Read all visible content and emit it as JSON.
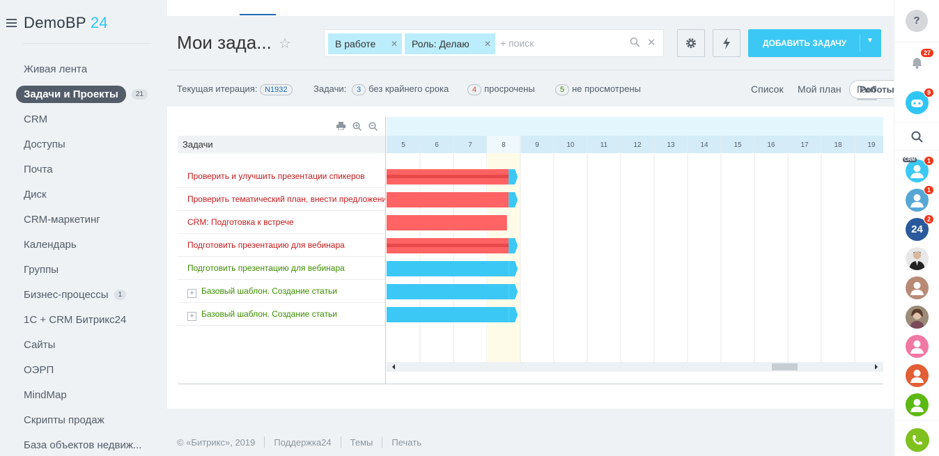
{
  "brand": {
    "name": "DemoBP",
    "num": "24"
  },
  "menu": [
    {
      "label": "Живая лента"
    },
    {
      "label": "Задачи и Проекты",
      "count": "21",
      "active": true
    },
    {
      "label": "CRM"
    },
    {
      "label": "Доступы"
    },
    {
      "label": "Почта"
    },
    {
      "label": "Диск"
    },
    {
      "label": "CRM-маркетинг"
    },
    {
      "label": "Календарь"
    },
    {
      "label": "Группы"
    },
    {
      "label": "Бизнес-процессы",
      "count": "1"
    },
    {
      "label": "1С + CRM Битрикс24"
    },
    {
      "label": "Сайты"
    },
    {
      "label": "ОЭРП"
    },
    {
      "label": "MindMap"
    },
    {
      "label": "Скрипты продаж"
    },
    {
      "label": "База объектов недвиж..."
    }
  ],
  "page": {
    "title": "Мои зада..."
  },
  "filter": {
    "chip1": "В работе",
    "chip2": "Роль: Делаю",
    "placeholder": "+ поиск"
  },
  "toolbar": {
    "add_task": "ДОБАВИТЬ ЗАДАЧУ"
  },
  "subbar": {
    "iteration_label": "Текущая итерация:",
    "iteration_value": "N1932",
    "tasks_label": "Задачи:",
    "no_deadline_count": "3",
    "no_deadline_label": "без крайнего срока",
    "overdue_count": "4",
    "overdue_label": "просрочены",
    "unseen_count": "5",
    "unseen_label": "не просмотрены",
    "robots": "Роботы",
    "views": [
      "Список",
      "Мой план",
      "Гант"
    ]
  },
  "gantt": {
    "column_header": "Задачи",
    "days": [
      "5",
      "6",
      "7",
      "8",
      "9",
      "10",
      "11",
      "12",
      "13",
      "14",
      "15",
      "16",
      "17",
      "18",
      "19"
    ],
    "today": "8",
    "tasks": [
      {
        "name": "Проверить и улучшить презентации спикеров",
        "status": "overdue",
        "start": 5,
        "end": 8.9,
        "arrow": true,
        "stripe": true
      },
      {
        "name": "Проверить тематический план, внести предложения",
        "status": "overdue",
        "start": 5,
        "end": 8.9,
        "arrow": true,
        "stripe": false
      },
      {
        "name": "CRM: Подготовка к встрече",
        "status": "overdue",
        "start": 5,
        "end": 8.6,
        "arrow": false,
        "stripe": false
      },
      {
        "name": "Подготовить презентацию для вебинара",
        "status": "overdue",
        "start": 5,
        "end": 8.9,
        "arrow": true,
        "stripe": true
      },
      {
        "name": "Подготовить презентацию для вебинара",
        "status": "active",
        "start": 5,
        "end": 8.9,
        "arrow": true,
        "stripe": false
      },
      {
        "name": "Базовый шаблон. Создание статьи",
        "status": "active",
        "start": 5,
        "end": 8.9,
        "arrow": true,
        "stripe": false,
        "expandable": true
      },
      {
        "name": "Базовый шаблон. Создание статьи",
        "status": "active",
        "start": 5,
        "end": 8.9,
        "arrow": true,
        "stripe": false,
        "expandable": true
      }
    ]
  },
  "footer": {
    "copyright": "© «Битрикс», 2019",
    "support": "Поддержка24",
    "themes": "Темы",
    "print": "Печать"
  },
  "right_panel": {
    "help": "?",
    "notifications": "27",
    "robot_badge": "9",
    "crm_tag": "CRM",
    "badges": [
      "1",
      "1",
      "2"
    ],
    "logo24": "24"
  },
  "colors": {
    "accent": "#3bc8f5",
    "overdue_text": "#c7191b",
    "active_text": "#3b8d00",
    "overdue_bar": "#ff6363",
    "active_bar": "#3bc8f5"
  }
}
